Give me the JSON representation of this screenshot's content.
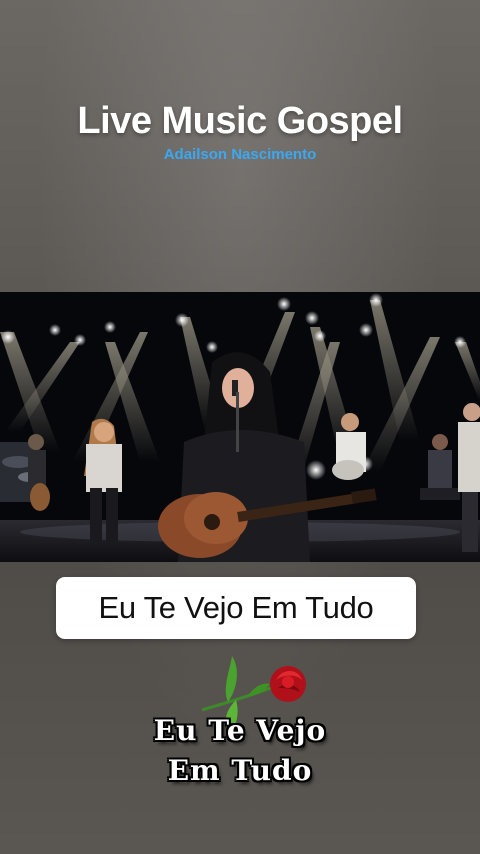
{
  "header": {
    "title": "Live Music Gospel",
    "subtitle": "Adailson Nascimento",
    "subtitle_color": "#3aa8f2"
  },
  "video": {
    "scene": "live-band-stage"
  },
  "caption": {
    "song_title": "Eu Te Vejo Em Tudo"
  },
  "decoration": {
    "icon": "rose-icon",
    "line1": "Eu Te Vejo",
    "line2": "Em Tudo"
  }
}
